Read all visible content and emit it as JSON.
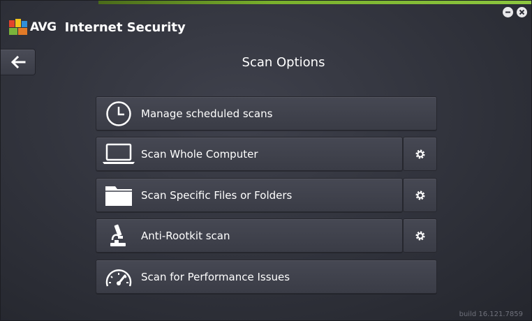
{
  "app": {
    "brand": "AVG",
    "product": "Internet Security",
    "accent_color": "#8cc63f"
  },
  "window_controls": {
    "minimize_icon": "minimize-icon",
    "close_icon": "close-icon"
  },
  "nav": {
    "back_icon": "arrow-left-icon"
  },
  "page": {
    "title": "Scan Options"
  },
  "options": [
    {
      "label": "Manage scheduled scans",
      "icon": "clock-icon",
      "has_settings": false
    },
    {
      "label": "Scan Whole Computer",
      "icon": "laptop-icon",
      "has_settings": true
    },
    {
      "label": "Scan Specific Files or Folders",
      "icon": "folder-icon",
      "has_settings": true
    },
    {
      "label": "Anti-Rootkit scan",
      "icon": "microscope-icon",
      "has_settings": true
    },
    {
      "label": "Scan for Performance Issues",
      "icon": "speedometer-icon",
      "has_settings": false
    }
  ],
  "footer": {
    "build": "build 16.121.7859"
  }
}
